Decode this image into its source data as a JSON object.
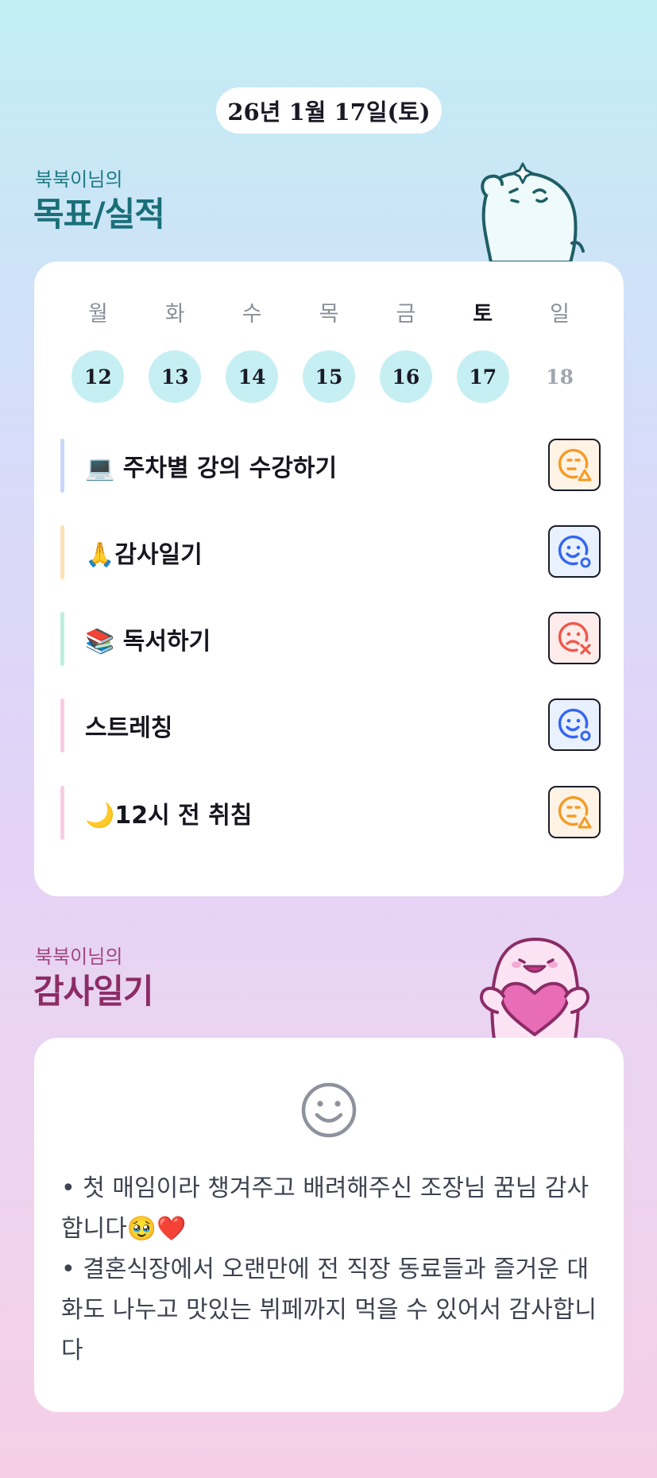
{
  "date_label": "26년 1월 17일(토)",
  "goals_section": {
    "subtitle": "북북이님의",
    "title": "목표/실적"
  },
  "week": [
    {
      "day": "월",
      "date": "12",
      "highlighted": true
    },
    {
      "day": "화",
      "date": "13",
      "highlighted": true
    },
    {
      "day": "수",
      "date": "14",
      "highlighted": true
    },
    {
      "day": "목",
      "date": "15",
      "highlighted": true
    },
    {
      "day": "금",
      "date": "16",
      "highlighted": true
    },
    {
      "day": "토",
      "date": "17",
      "highlighted": true,
      "today": true
    },
    {
      "day": "일",
      "date": "18",
      "highlighted": false
    }
  ],
  "goals": [
    {
      "text": "💻 주차별 강의 수강하기",
      "bar_color": "#c9d7fb",
      "status_icon": "face-warning-icon",
      "status_color": "#f59a23"
    },
    {
      "text": "🙏감사일기",
      "bar_color": "#fde0b4",
      "status_icon": "face-done-icon",
      "status_color": "#3466f0"
    },
    {
      "text": "📚 독서하기",
      "bar_color": "#bdf0de",
      "status_icon": "face-fail-icon",
      "status_color": "#f0574c"
    },
    {
      "text": "스트레칭",
      "bar_color": "#f9cce3",
      "status_icon": "face-done-icon",
      "status_color": "#3466f0"
    },
    {
      "text": "🌙12시 전 취침",
      "bar_color": "#f9cce3",
      "status_icon": "face-warning-icon",
      "status_color": "#f59a23"
    }
  ],
  "gratitude_section": {
    "subtitle": "북북이님의",
    "title": "감사일기",
    "mood_icon": "smiley-icon",
    "entries": [
      "•  첫 매임이라 챙겨주고 배려해주신 조장님 꿈님 감사합니다🥹❤️",
      "•  결혼식장에서 오랜만에 전 직장 동료들과 즐거운 대화도 나누고 맛있는 뷔페까지 먹을 수 있어서 감사합니다"
    ]
  }
}
